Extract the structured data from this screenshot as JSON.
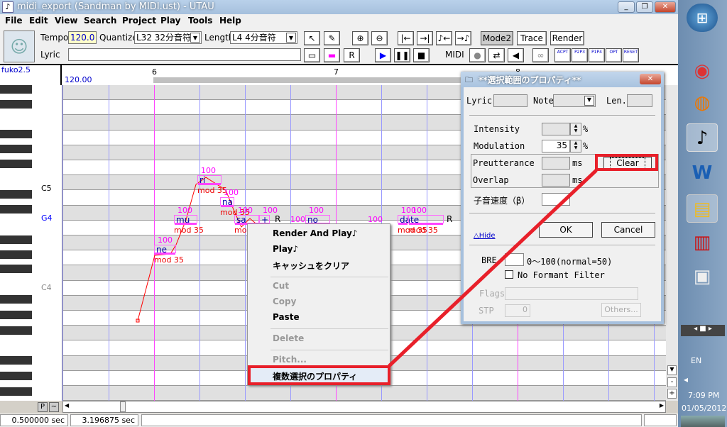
{
  "window": {
    "title": "midi_export (Sandman by MIDI.ust) - UTAU"
  },
  "menu": [
    "File",
    "Edit",
    "View",
    "Search",
    "Project",
    "Play",
    "Tools",
    "Help"
  ],
  "toolbar": {
    "tempo_label": "Tempo",
    "tempo_value": "120.0",
    "quantize_label": "Quantize",
    "quantize_value": "L32 32分音符",
    "length_label": "Length",
    "length_value": "L4  4分音符",
    "lyric_label": "Lyric",
    "lyric_value": "",
    "mode2": "Mode2",
    "trace": "Trace",
    "render": "Render",
    "midi_label": "MIDI",
    "env_buttons": [
      "ACPT",
      "P2P3",
      "P1P4",
      "OPT",
      "RESET"
    ]
  },
  "header": {
    "singer": "fuko2.5",
    "tempo": "120.00",
    "measures": [
      "6",
      "7",
      "8"
    ]
  },
  "keys": {
    "c5": "C5",
    "g4": "G4",
    "c4": "C4"
  },
  "notes": [
    {
      "lyric": "ne",
      "vel": "100",
      "mod": "mod 35"
    },
    {
      "lyric": "mu",
      "vel": "100",
      "mod": "mod 35"
    },
    {
      "lyric": "ri",
      "vel": "100",
      "mod": "mod 35"
    },
    {
      "lyric": "na",
      "vel": "100",
      "mod": "mod 35"
    },
    {
      "lyric": "sa",
      "vel": "100",
      "mod": "mod"
    },
    {
      "lyric": "+",
      "vel": "100",
      "mod": ""
    },
    {
      "lyric": "R",
      "vel": "",
      "mod": ""
    },
    {
      "lyric": "no",
      "vel": "100",
      "mod": "mod"
    },
    {
      "lyric": "da",
      "vel": "100",
      "mod": "mod 35"
    },
    {
      "lyric": "te",
      "vel": "100",
      "mod": "mod 35"
    },
    {
      "lyric": "R",
      "vel": "",
      "mod": ""
    }
  ],
  "extra_vels": [
    "100",
    "100"
  ],
  "context_menu": {
    "items": [
      {
        "label": "Render And Play♪",
        "enabled": true
      },
      {
        "label": "Play♪",
        "enabled": true
      },
      {
        "label": "キャッシュをクリア",
        "enabled": true
      },
      {
        "label": "Cut",
        "enabled": false
      },
      {
        "label": "Copy",
        "enabled": false
      },
      {
        "label": "Paste",
        "enabled": true
      },
      {
        "label": "Delete",
        "enabled": false
      },
      {
        "label": "Pitch...",
        "enabled": false
      },
      {
        "label": "複数選択のプロパティ",
        "enabled": true
      }
    ]
  },
  "dialog": {
    "title": "**選択範囲のプロパティ**",
    "lyric": "Lyric",
    "note": "Note",
    "len": "Len.",
    "intensity": "Intensity",
    "modulation": "Modulation",
    "modulation_value": "35",
    "percent": "%",
    "preutterance": "Preutterance",
    "overlap": "Overlap",
    "ms": "ms",
    "clear": "Clear",
    "consonant": "子音速度（β）",
    "ok": "OK",
    "cancel": "Cancel",
    "hide": "△Hide",
    "bre": "BRE",
    "bre_range": "0～100(normal=50)",
    "no_formant": "No Formant Filter",
    "no_formant_checked": false,
    "flags": "Flags",
    "stp": "STP",
    "stp_value": "0",
    "others": "Others..."
  },
  "roll_buttons": {
    "p": "P",
    "tilde": "~",
    "minus": "-",
    "plus": "+"
  },
  "status": {
    "time1": "0.500000 sec",
    "time2": "3.196875 sec"
  },
  "taskbar": {
    "lang": "EN",
    "time": "7:09 PM",
    "date": "01/05/2012"
  },
  "colors": {
    "highlight": "#e8202a",
    "note_bar": "#ff44ff",
    "pitch": "#ff0000"
  }
}
